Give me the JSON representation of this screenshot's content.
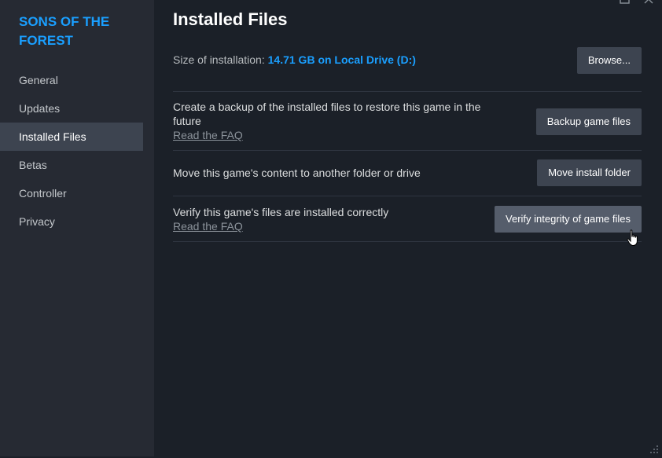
{
  "sidebar": {
    "game_title": "SONS OF THE FOREST",
    "items": [
      {
        "label": "General"
      },
      {
        "label": "Updates"
      },
      {
        "label": "Installed Files"
      },
      {
        "label": "Betas"
      },
      {
        "label": "Controller"
      },
      {
        "label": "Privacy"
      }
    ],
    "active_item": "Installed Files"
  },
  "main": {
    "title": "Installed Files",
    "size_label": "Size of installation:",
    "size_value": "14.71 GB on Local Drive (D:)",
    "browse_label": "Browse...",
    "rows": [
      {
        "text": "Create a backup of the installed files to restore this game in the future",
        "link": "Read the FAQ",
        "button": "Backup game files"
      },
      {
        "text": "Move this game's content to another folder or drive",
        "button": "Move install folder"
      },
      {
        "text": "Verify this game's files are installed correctly",
        "link": "Read the FAQ",
        "button": "Verify integrity of game files"
      }
    ]
  },
  "colors": {
    "accent": "#1a9fff",
    "sidebar_bg": "#262a33",
    "main_bg": "#1b2028",
    "button_bg": "#3d4450",
    "button_hover_bg": "#555d6b"
  },
  "icons": [
    "maximize-icon",
    "close-icon",
    "hand-pointer-icon",
    "resize-grip-icon"
  ]
}
